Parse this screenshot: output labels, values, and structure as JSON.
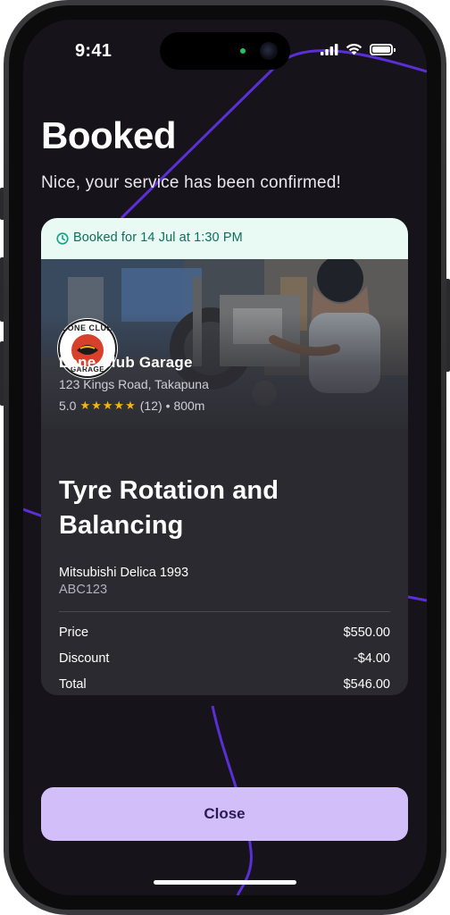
{
  "status_bar": {
    "time": "9:41"
  },
  "page": {
    "title": "Booked",
    "subtitle": "Nice, your service has been confirmed!"
  },
  "booking": {
    "booked_label": "Booked for 14 Jul at 1:30 PM",
    "garage": {
      "name": "Lone Club Garage",
      "address": "123 Kings Road, Takapuna",
      "rating": "5.0",
      "stars": "★★★★★",
      "reviews": "(12)",
      "distance": "• 800m",
      "logo_text_top": "LONE CLUB",
      "logo_text_bottom": "GARAGE"
    },
    "service_title": "Tyre Rotation and Balancing",
    "vehicle": {
      "name": "Mitsubishi Delica 1993",
      "plate": "ABC123"
    },
    "pricing": [
      {
        "label": "Price",
        "value": "$550.00"
      },
      {
        "label": "Discount",
        "value": "-$4.00"
      },
      {
        "label": "Total",
        "value": "$546.00"
      }
    ]
  },
  "actions": {
    "close_label": "Close"
  },
  "colors": {
    "background": "#16131b",
    "accent_line": "#5a2fd6",
    "booked_strip": "#e9faf5",
    "booked_text": "#0f6e5b",
    "card": "#2b2a31",
    "close_button": "#d2bff9",
    "star": "#f5b50a"
  },
  "icons": {
    "clock": "clock-icon",
    "signal": "cellular-signal-icon",
    "wifi": "wifi-icon",
    "battery": "battery-icon"
  }
}
